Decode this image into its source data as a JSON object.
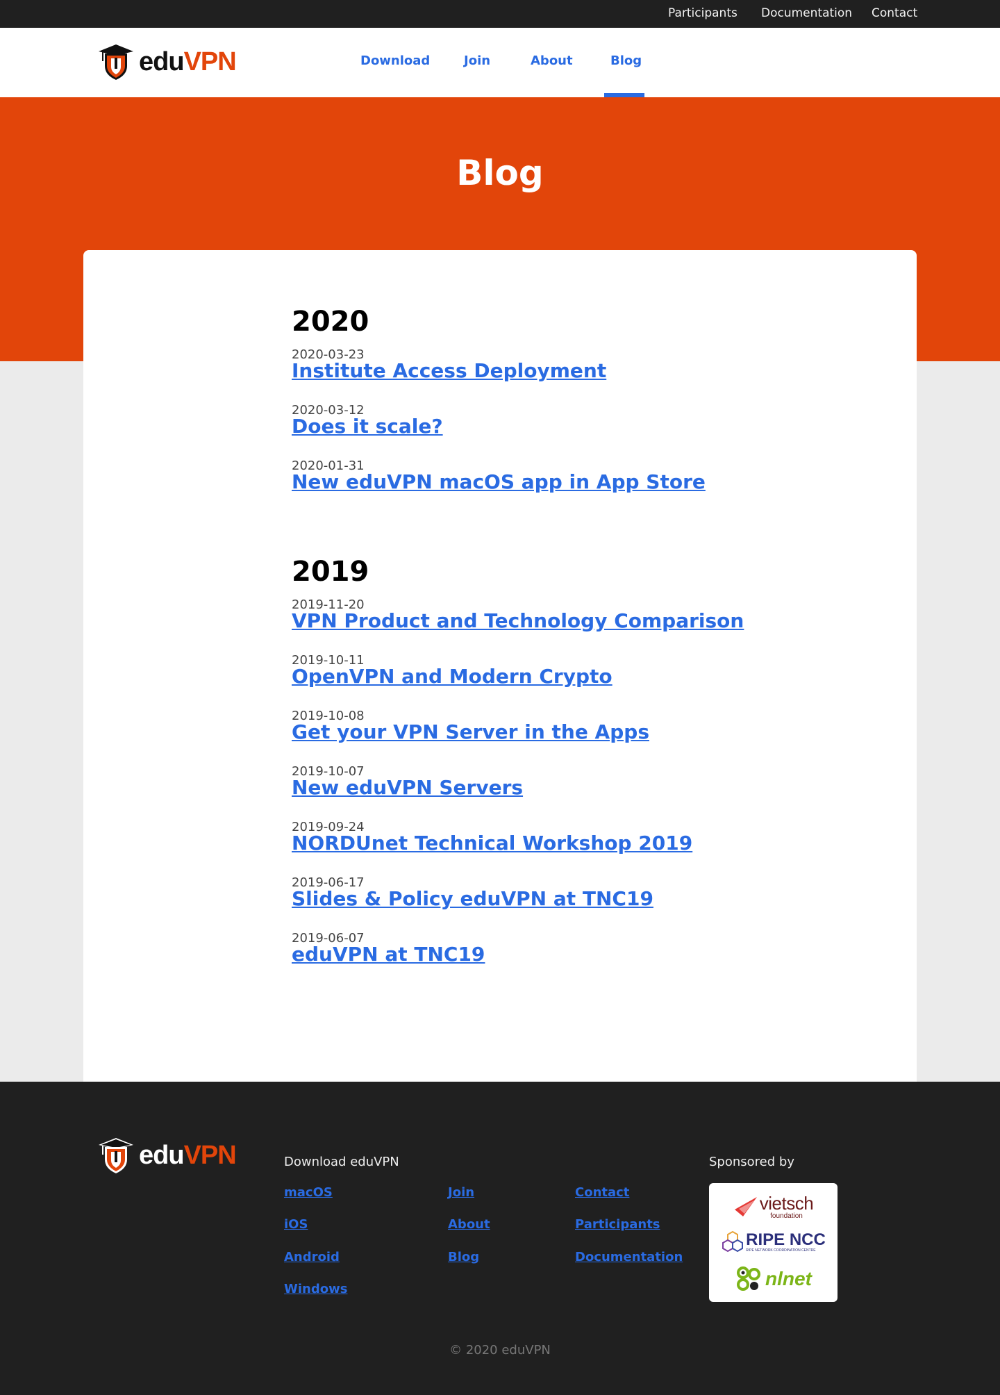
{
  "topbar": {
    "links": [
      "Participants",
      "Documentation",
      "Contact"
    ]
  },
  "brand": {
    "edu": "edu",
    "vpn": "VPN"
  },
  "nav": {
    "items": [
      "Download",
      "Join",
      "About",
      "Blog"
    ],
    "active": "Blog"
  },
  "hero": {
    "title": "Blog"
  },
  "blog": {
    "sections": [
      {
        "year": "2020",
        "posts": [
          {
            "date": "2020-03-23",
            "title": "Institute Access Deployment"
          },
          {
            "date": "2020-03-12",
            "title": "Does it scale?"
          },
          {
            "date": "2020-01-31",
            "title": "New eduVPN macOS app in App Store"
          }
        ]
      },
      {
        "year": "2019",
        "posts": [
          {
            "date": "2019-11-20",
            "title": "VPN Product and Technology Comparison"
          },
          {
            "date": "2019-10-11",
            "title": "OpenVPN and Modern Crypto"
          },
          {
            "date": "2019-10-08",
            "title": "Get your VPN Server in the Apps"
          },
          {
            "date": "2019-10-07",
            "title": "New eduVPN Servers"
          },
          {
            "date": "2019-09-24",
            "title": "NORDUnet Technical Workshop 2019"
          },
          {
            "date": "2019-06-17",
            "title": "Slides & Policy eduVPN at TNC19"
          },
          {
            "date": "2019-06-07",
            "title": "eduVPN at TNC19"
          }
        ]
      }
    ]
  },
  "footer": {
    "download_heading": "Download eduVPN",
    "col1": [
      "macOS",
      "iOS",
      "Android",
      "Windows"
    ],
    "col2": [
      "Join",
      "About",
      "Blog"
    ],
    "col3": [
      "Contact",
      "Participants",
      "Documentation"
    ],
    "sponsored_heading": "Sponsored by",
    "sponsors": {
      "vietsch": "vietsch",
      "vietsch_sub": "foundation",
      "ripe": "RIPE NCC",
      "ripe_sub": "RIPE NETWORK COORDINATION CENTRE",
      "nlnet": "nlnet"
    },
    "copyright": "© 2020 eduVPN"
  },
  "colors": {
    "accent_orange": "#e2450a",
    "link_blue": "#2a6be2",
    "dark": "#202020",
    "page_bg": "#ebebeb"
  }
}
